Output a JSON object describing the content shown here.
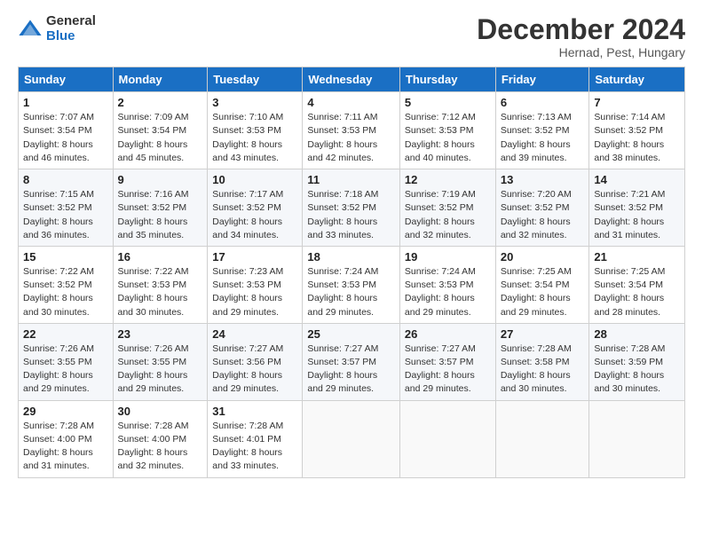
{
  "logo": {
    "general": "General",
    "blue": "Blue"
  },
  "header": {
    "month": "December 2024",
    "location": "Hernad, Pest, Hungary"
  },
  "weekdays": [
    "Sunday",
    "Monday",
    "Tuesday",
    "Wednesday",
    "Thursday",
    "Friday",
    "Saturday"
  ],
  "weeks": [
    [
      {
        "day": 1,
        "sunrise": "7:07 AM",
        "sunset": "3:54 PM",
        "daylight": "8 hours and 46 minutes."
      },
      {
        "day": 2,
        "sunrise": "7:09 AM",
        "sunset": "3:54 PM",
        "daylight": "8 hours and 45 minutes."
      },
      {
        "day": 3,
        "sunrise": "7:10 AM",
        "sunset": "3:53 PM",
        "daylight": "8 hours and 43 minutes."
      },
      {
        "day": 4,
        "sunrise": "7:11 AM",
        "sunset": "3:53 PM",
        "daylight": "8 hours and 42 minutes."
      },
      {
        "day": 5,
        "sunrise": "7:12 AM",
        "sunset": "3:53 PM",
        "daylight": "8 hours and 40 minutes."
      },
      {
        "day": 6,
        "sunrise": "7:13 AM",
        "sunset": "3:52 PM",
        "daylight": "8 hours and 39 minutes."
      },
      {
        "day": 7,
        "sunrise": "7:14 AM",
        "sunset": "3:52 PM",
        "daylight": "8 hours and 38 minutes."
      }
    ],
    [
      {
        "day": 8,
        "sunrise": "7:15 AM",
        "sunset": "3:52 PM",
        "daylight": "8 hours and 36 minutes."
      },
      {
        "day": 9,
        "sunrise": "7:16 AM",
        "sunset": "3:52 PM",
        "daylight": "8 hours and 35 minutes."
      },
      {
        "day": 10,
        "sunrise": "7:17 AM",
        "sunset": "3:52 PM",
        "daylight": "8 hours and 34 minutes."
      },
      {
        "day": 11,
        "sunrise": "7:18 AM",
        "sunset": "3:52 PM",
        "daylight": "8 hours and 33 minutes."
      },
      {
        "day": 12,
        "sunrise": "7:19 AM",
        "sunset": "3:52 PM",
        "daylight": "8 hours and 32 minutes."
      },
      {
        "day": 13,
        "sunrise": "7:20 AM",
        "sunset": "3:52 PM",
        "daylight": "8 hours and 32 minutes."
      },
      {
        "day": 14,
        "sunrise": "7:21 AM",
        "sunset": "3:52 PM",
        "daylight": "8 hours and 31 minutes."
      }
    ],
    [
      {
        "day": 15,
        "sunrise": "7:22 AM",
        "sunset": "3:52 PM",
        "daylight": "8 hours and 30 minutes."
      },
      {
        "day": 16,
        "sunrise": "7:22 AM",
        "sunset": "3:53 PM",
        "daylight": "8 hours and 30 minutes."
      },
      {
        "day": 17,
        "sunrise": "7:23 AM",
        "sunset": "3:53 PM",
        "daylight": "8 hours and 29 minutes."
      },
      {
        "day": 18,
        "sunrise": "7:24 AM",
        "sunset": "3:53 PM",
        "daylight": "8 hours and 29 minutes."
      },
      {
        "day": 19,
        "sunrise": "7:24 AM",
        "sunset": "3:53 PM",
        "daylight": "8 hours and 29 minutes."
      },
      {
        "day": 20,
        "sunrise": "7:25 AM",
        "sunset": "3:54 PM",
        "daylight": "8 hours and 29 minutes."
      },
      {
        "day": 21,
        "sunrise": "7:25 AM",
        "sunset": "3:54 PM",
        "daylight": "8 hours and 28 minutes."
      }
    ],
    [
      {
        "day": 22,
        "sunrise": "7:26 AM",
        "sunset": "3:55 PM",
        "daylight": "8 hours and 29 minutes."
      },
      {
        "day": 23,
        "sunrise": "7:26 AM",
        "sunset": "3:55 PM",
        "daylight": "8 hours and 29 minutes."
      },
      {
        "day": 24,
        "sunrise": "7:27 AM",
        "sunset": "3:56 PM",
        "daylight": "8 hours and 29 minutes."
      },
      {
        "day": 25,
        "sunrise": "7:27 AM",
        "sunset": "3:57 PM",
        "daylight": "8 hours and 29 minutes."
      },
      {
        "day": 26,
        "sunrise": "7:27 AM",
        "sunset": "3:57 PM",
        "daylight": "8 hours and 29 minutes."
      },
      {
        "day": 27,
        "sunrise": "7:28 AM",
        "sunset": "3:58 PM",
        "daylight": "8 hours and 30 minutes."
      },
      {
        "day": 28,
        "sunrise": "7:28 AM",
        "sunset": "3:59 PM",
        "daylight": "8 hours and 30 minutes."
      }
    ],
    [
      {
        "day": 29,
        "sunrise": "7:28 AM",
        "sunset": "4:00 PM",
        "daylight": "8 hours and 31 minutes."
      },
      {
        "day": 30,
        "sunrise": "7:28 AM",
        "sunset": "4:00 PM",
        "daylight": "8 hours and 32 minutes."
      },
      {
        "day": 31,
        "sunrise": "7:28 AM",
        "sunset": "4:01 PM",
        "daylight": "8 hours and 33 minutes."
      },
      null,
      null,
      null,
      null
    ]
  ]
}
